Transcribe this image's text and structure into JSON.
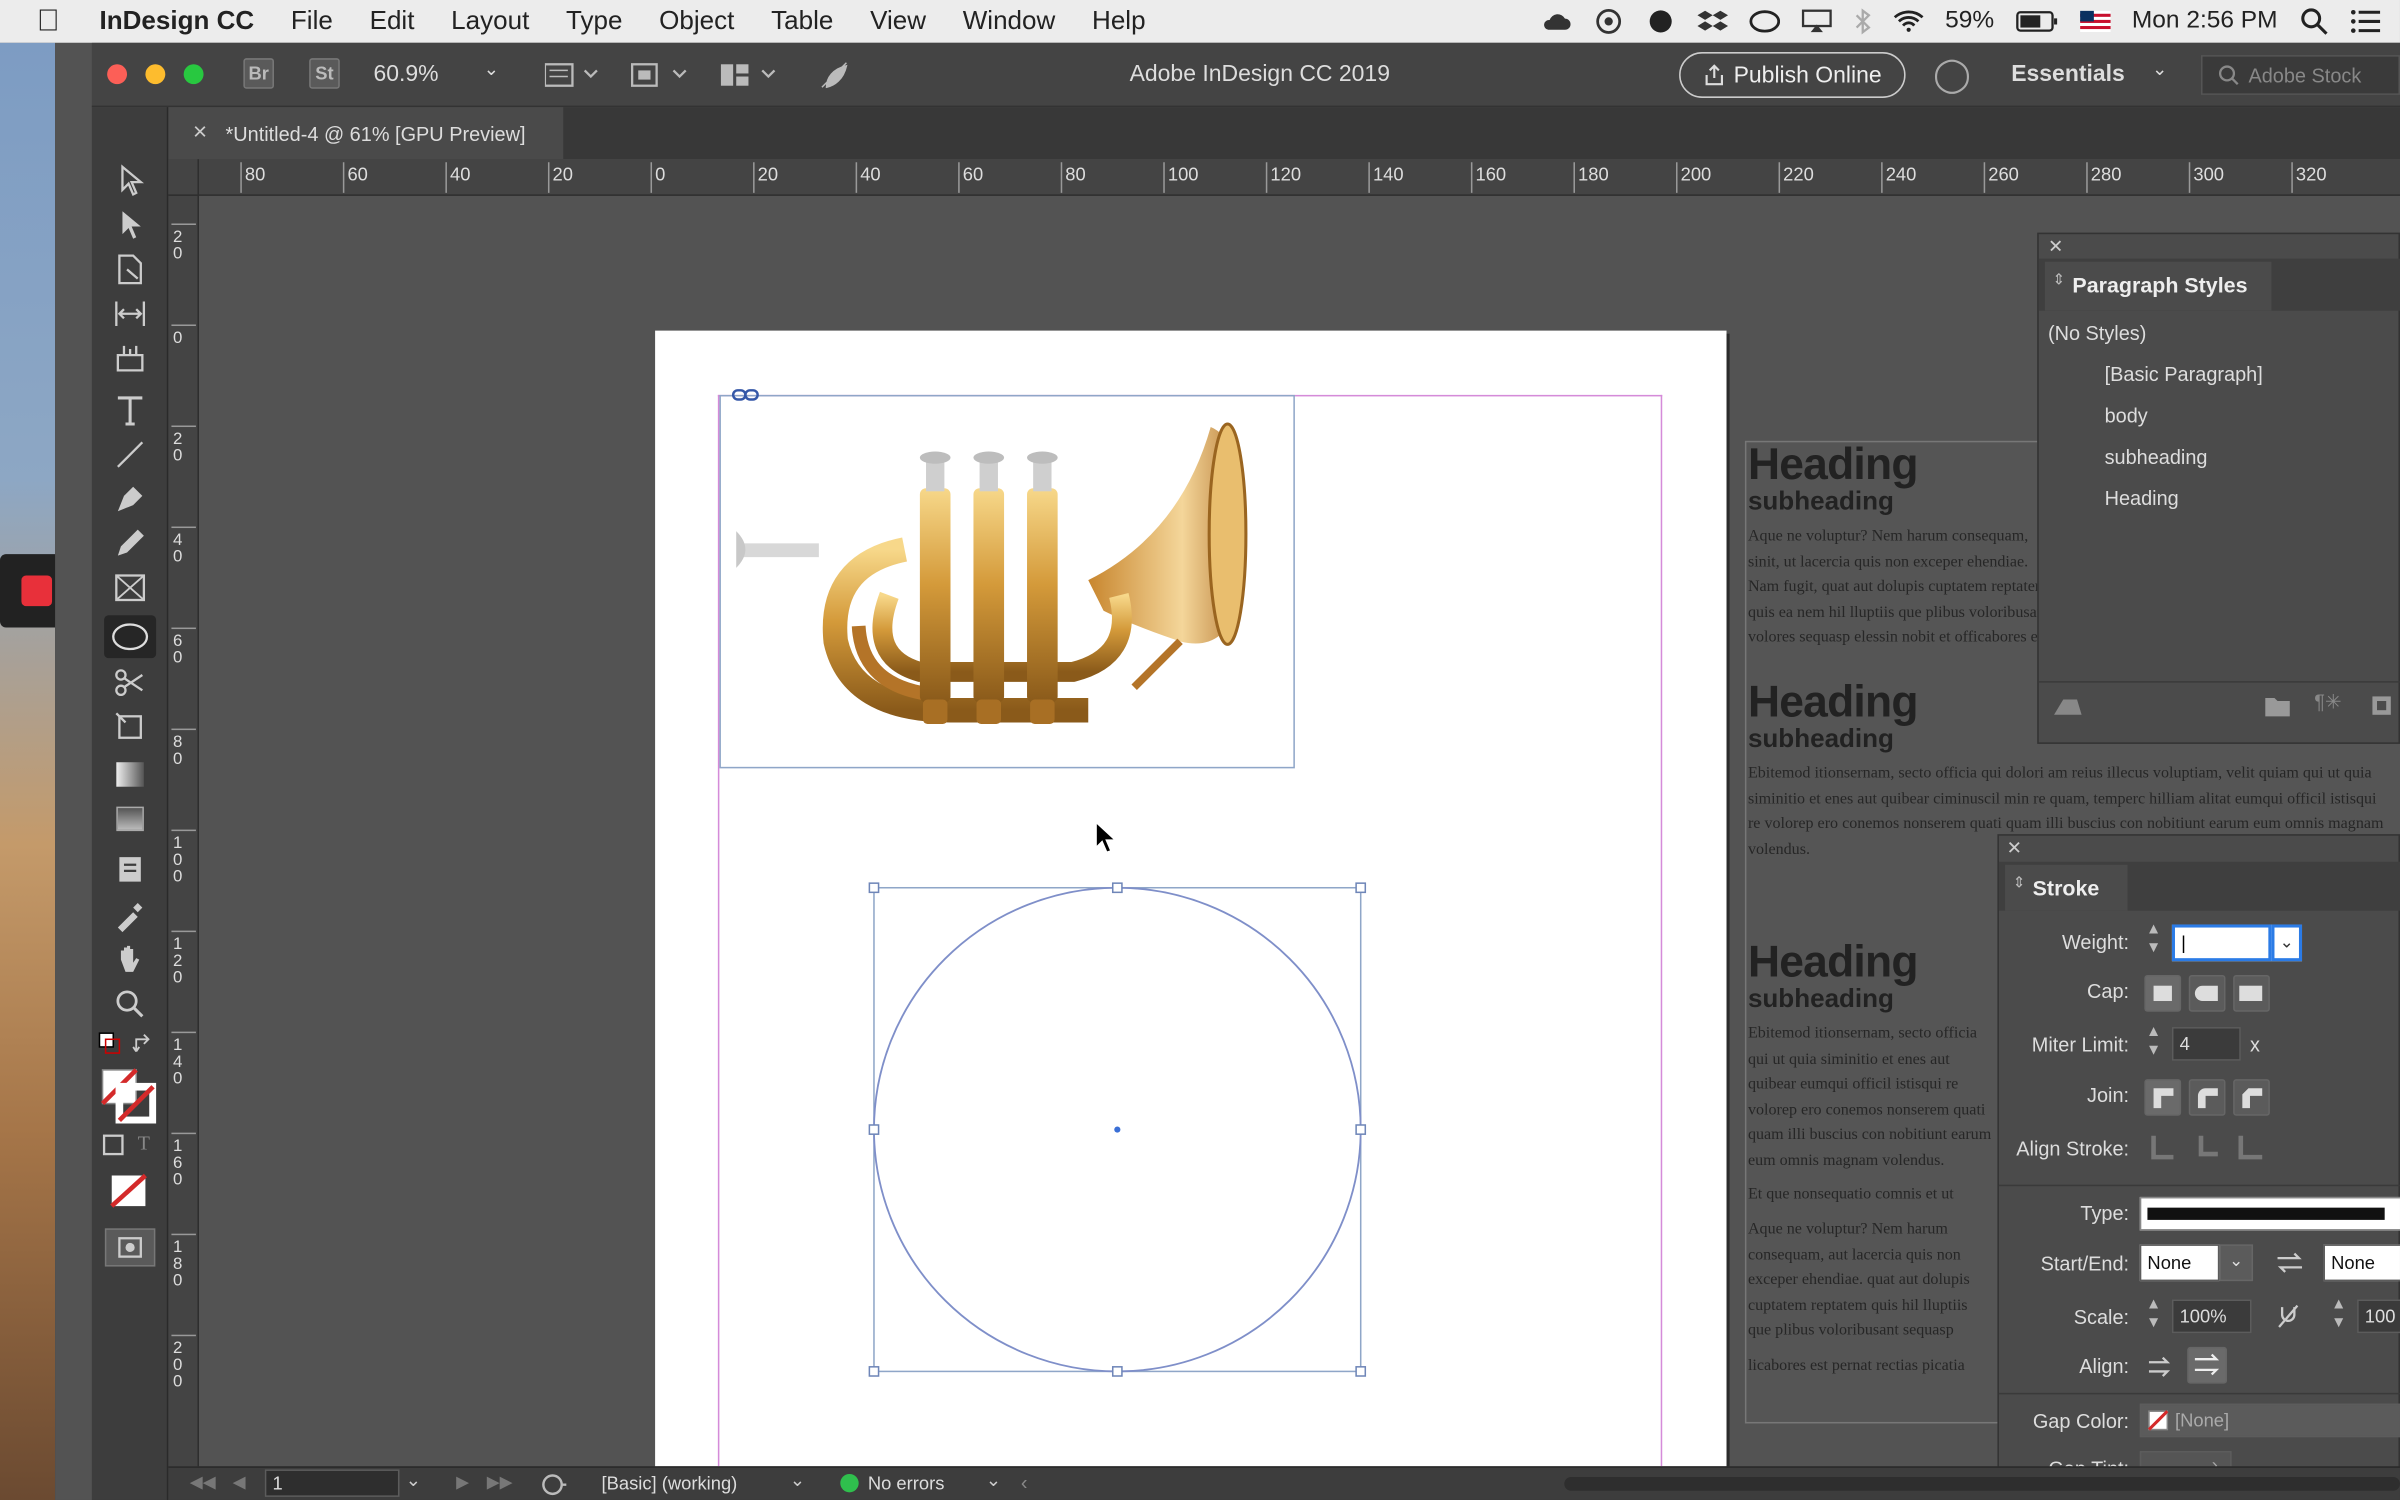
{
  "menubar": {
    "app": "InDesign CC",
    "items": [
      "File",
      "Edit",
      "Layout",
      "Type",
      "Object",
      "Table",
      "View",
      "Window",
      "Help"
    ],
    "battery": "59%",
    "clock": "Mon 2:56 PM"
  },
  "toolbar": {
    "bridge": "Br",
    "stock_btn": "St",
    "zoom": "60.9%",
    "app_title": "Adobe InDesign CC 2019",
    "publish": "Publish Online",
    "workspace": "Essentials",
    "search_placeholder": "Adobe Stock"
  },
  "document_tab": {
    "close": "×",
    "title": "*Untitled-4 @ 61% [GPU Preview]"
  },
  "hruler": [
    "80",
    "60",
    "40",
    "20",
    "0",
    "20",
    "40",
    "60",
    "80",
    "100",
    "120",
    "140",
    "160",
    "180",
    "200",
    "220",
    "240",
    "260",
    "280",
    "300",
    "320"
  ],
  "vruler": [
    "20",
    "0",
    "20",
    "40",
    "60",
    "80",
    "100",
    "120",
    "140",
    "160",
    "180",
    "200"
  ],
  "text_frame": {
    "blocks": [
      {
        "heading": "Heading",
        "subheading": "subheading",
        "body": "Aque ne voluptur? Nem harum consequam, sinit, ut lacercia quis non exceper ehendiae. Nam fugit, quat aut dolupis cuptatem reptatem quis ea nem hil lluptiis que plibus voloribusant volores sequasp elessin nobit et officabores et exeribus."
      },
      {
        "heading": "Heading",
        "subheading": "subheading",
        "body": "Ebitemod itionsernam, secto officia qui dolori am reius illecus voluptiam, velit quiam qui ut quia siminitio et enes aut quibear ciminuscil min re quam, temperc hilliam alitat eumqui officil istisqui re volorep ero conemos nonserem quati quam illi buscius con nobitiunt earum eum omnis magnam volendus."
      },
      {
        "heading": "Heading",
        "subheading": "subheading",
        "body": "Ebitemod itionsernam, secto officia qui ut quia siminitio et enes aut quibear eumqui officil istisqui re volorep ero conemos nonserem quati quam illi buscius con nobitiunt earum eum omnis magnam volendus.",
        "extra": "Et que nonsequatio comnis et ut laborem.",
        "extra2": "Aque ne voluptur? Nem harum consequam, aut lacercia quis non exceper ehendiae. quat aut dolupis cuptatem reptatem quis hil lluptiis que plibus voloribusant sequasp elessin nobit et officabores.",
        "extra3": "licabores est pernat rectias picatia volupt."
      }
    ]
  },
  "paragraph_styles": {
    "title": "Paragraph Styles",
    "no_styles": "(No Styles)",
    "items": [
      "[Basic Paragraph]",
      "body",
      "subheading",
      "Heading"
    ]
  },
  "stroke": {
    "title": "Stroke",
    "weight_label": "Weight:",
    "weight_value": "|",
    "cap_label": "Cap:",
    "miter_label": "Miter Limit:",
    "miter_value": "4",
    "miter_unit": "x",
    "join_label": "Join:",
    "align_label": "Align Stroke:",
    "type_label": "Type:",
    "startend_label": "Start/End:",
    "start_value": "None",
    "end_value": "None",
    "scale_label": "Scale:",
    "scale_start": "100%",
    "scale_end": "100",
    "align2_label": "Align:",
    "gap_color_label": "Gap Color:",
    "gap_color_value": "[None]",
    "gap_tint_label": "Gap Tint:"
  },
  "status": {
    "page": "1",
    "preflight_profile": "[Basic] (working)",
    "errors": "No errors"
  },
  "colors": {
    "accent": "#d42a2a",
    "frame": "#8fa6c8",
    "margin": "#d58bd9",
    "ok": "#2fbf4d"
  }
}
